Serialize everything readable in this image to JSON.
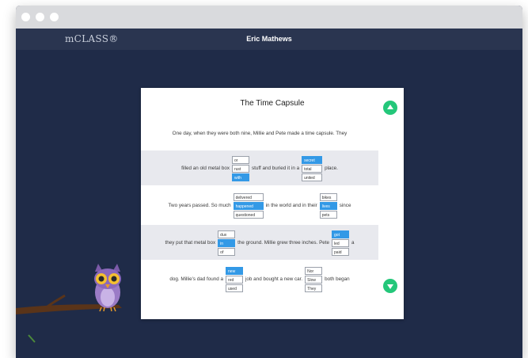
{
  "header": {
    "logo": "mCLASS®",
    "user_name": "Eric Mathews"
  },
  "passage": {
    "title": "The Time Capsule",
    "intro": "One day, when they were both nine, Millie and Pete made a time capsule. They",
    "rows": [
      {
        "texts": [
          "filled an old metal box",
          "stuff and buried it in a",
          "place."
        ],
        "choices": [
          {
            "options": [
              "or",
              "rust",
              "with"
            ],
            "selected": 2
          },
          {
            "options": [
              "secret",
              "total",
              "united"
            ],
            "selected": 0
          }
        ]
      },
      {
        "texts": [
          "Two years passed. So much",
          "in the world and in their",
          "since"
        ],
        "choices": [
          {
            "options": [
              "delivered",
              "happened",
              "questioned"
            ],
            "selected": 1
          },
          {
            "options": [
              "bikes",
              "lives",
              "pets"
            ],
            "selected": 1
          }
        ]
      },
      {
        "texts": [
          "they put that metal box",
          "the ground. Millie grew three inches. Pete",
          "a"
        ],
        "choices": [
          {
            "options": [
              "dux",
              "in",
              "of"
            ],
            "selected": 1
          },
          {
            "options": [
              "got",
              "led",
              "paid"
            ],
            "selected": 0
          }
        ]
      },
      {
        "texts": [
          "dog. Millie's dad found a",
          "job and bought a new car.",
          "both began"
        ],
        "choices": [
          {
            "options": [
              "new",
              "red",
              "used"
            ],
            "selected": 0
          },
          {
            "options": [
              "Nor",
              "Slow",
              "They"
            ],
            "selected": -1
          }
        ]
      }
    ]
  },
  "colors": {
    "selected_option": "#3399e6",
    "scroll_button": "#24c77a",
    "background": "#1f2b48"
  },
  "icons": {
    "scroll_up": "triangle-up",
    "scroll_down": "triangle-down",
    "mascot": "owl"
  }
}
